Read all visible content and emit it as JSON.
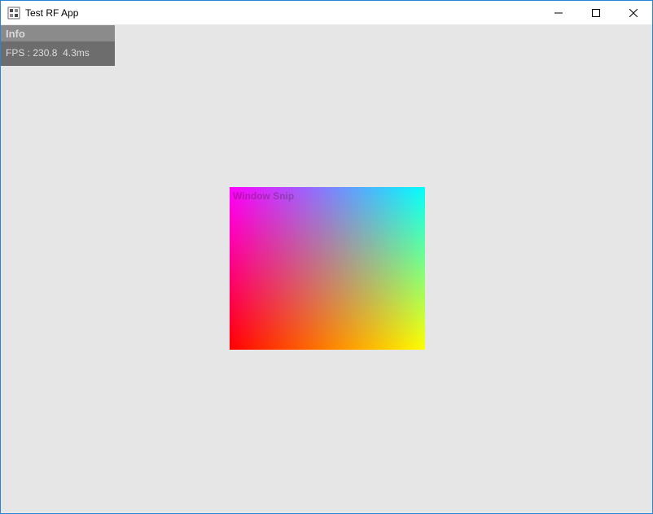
{
  "window": {
    "title": "Test RF App"
  },
  "info_panel": {
    "header": "Info",
    "fps_label": "FPS :",
    "fps_value": "230.8",
    "frame_time": "4.3ms"
  },
  "viewport": {
    "quad_title": "Window Snip",
    "corners": {
      "top_left": "#ff00ff",
      "top_right": "#00ffff",
      "bottom_left": "#ff0000",
      "bottom_right": "#ffff00"
    }
  }
}
